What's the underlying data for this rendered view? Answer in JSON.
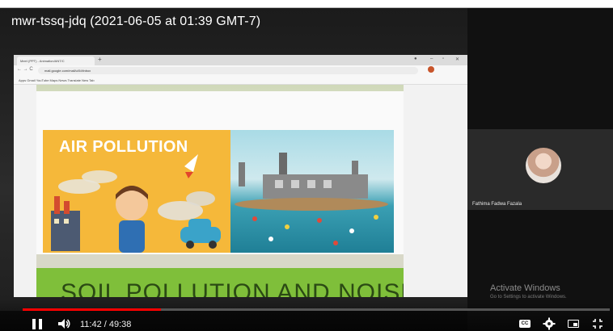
{
  "video": {
    "title": "mwr-tssq-jdq (2021-06-05 at 01:39 GMT-7)",
    "current_time": "11:42",
    "duration": "49:38",
    "time_text": "11:42 / 49:38",
    "progress_fraction": 0.2358,
    "accent_color": "#ff0000"
  },
  "browser": {
    "tab_title": "Meet (PPT) - Animation/ANT/C",
    "url": "mail.google.com/mail/u/0/#inbox",
    "bookmarks": "Apps  Gmail  YouTube  Maps  News  Translate  New Tab"
  },
  "slide": {
    "air_title": "AIR POLLUTION",
    "soil_title": "SOIL POLLUTION AND NOISE"
  },
  "participant": {
    "name": "Fathima Fadwa Fazala"
  },
  "watermark": {
    "title": "Activate Windows",
    "subtitle": "Go to Settings to activate Windows."
  },
  "controls": {
    "captions_label": "CC"
  },
  "icons": [
    "pause-icon",
    "volume-icon",
    "captions-icon",
    "settings-gear-icon",
    "miniplayer-icon",
    "fullscreen-exit-icon"
  ]
}
